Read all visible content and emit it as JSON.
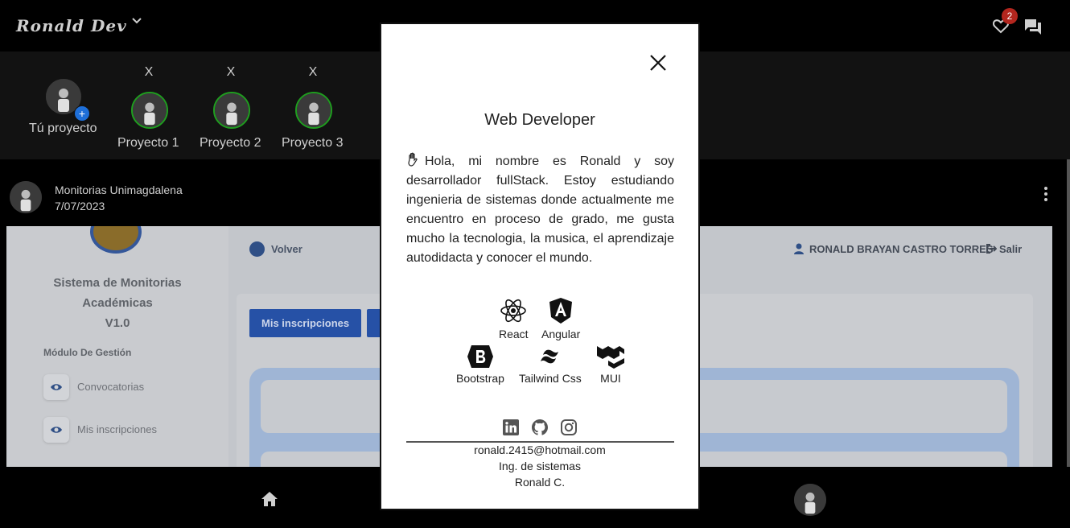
{
  "app": {
    "brand": "Ronald Dev",
    "notifications_count": "2"
  },
  "stories": {
    "own": {
      "label": "Tú proyecto",
      "add_icon": "+"
    },
    "items": [
      {
        "label": "Proyecto 1",
        "close": "X"
      },
      {
        "label": "Proyecto 2",
        "close": "X"
      },
      {
        "label": "Proyecto 3",
        "close": "X"
      }
    ]
  },
  "post": {
    "author": "Monitorias Unimagdalena",
    "date": "7/07/2023",
    "image": {
      "sidebar_title_lines": [
        "Sistema de Monitorias",
        "Académicas",
        "V1.0"
      ],
      "section_label": "Módulo De Gestión",
      "menu_items": [
        "Convocatorias",
        "Mis inscripciones"
      ],
      "back_label": "Volver",
      "user_name": "RONALD BRAYAN CASTRO TORRES",
      "logout_label": "Salir",
      "button_label": "Mis inscripciones"
    }
  },
  "modal": {
    "title": "Web Developer",
    "bio": "Hola, mi nombre es Ronald y soy desarrollador fullStack. Estoy estudiando ingenieria de sistemas donde actualmente me encuentro en proceso de grado, me gusta mucho la tecnologia, la musica, el aprendizaje autodidacta y conocer el mundo.",
    "technologies": [
      {
        "name": "React",
        "icon": "react-icon"
      },
      {
        "name": "Angular",
        "icon": "angular-icon"
      },
      {
        "name": "Bootstrap",
        "icon": "bootstrap-icon"
      },
      {
        "name": "Tailwind Css",
        "icon": "tailwind-icon"
      },
      {
        "name": "MUI",
        "icon": "mui-icon"
      }
    ],
    "social": [
      "linkedin-icon",
      "github-icon",
      "instagram-icon"
    ],
    "email": "ronald.2415@hotmail.com",
    "profession": "Ing. de sistemas",
    "signature": "Ronald C."
  },
  "colors": {
    "story_ring": "#1f9d1f",
    "badge": "#b3261e",
    "add_badge": "#1e6fd9"
  }
}
